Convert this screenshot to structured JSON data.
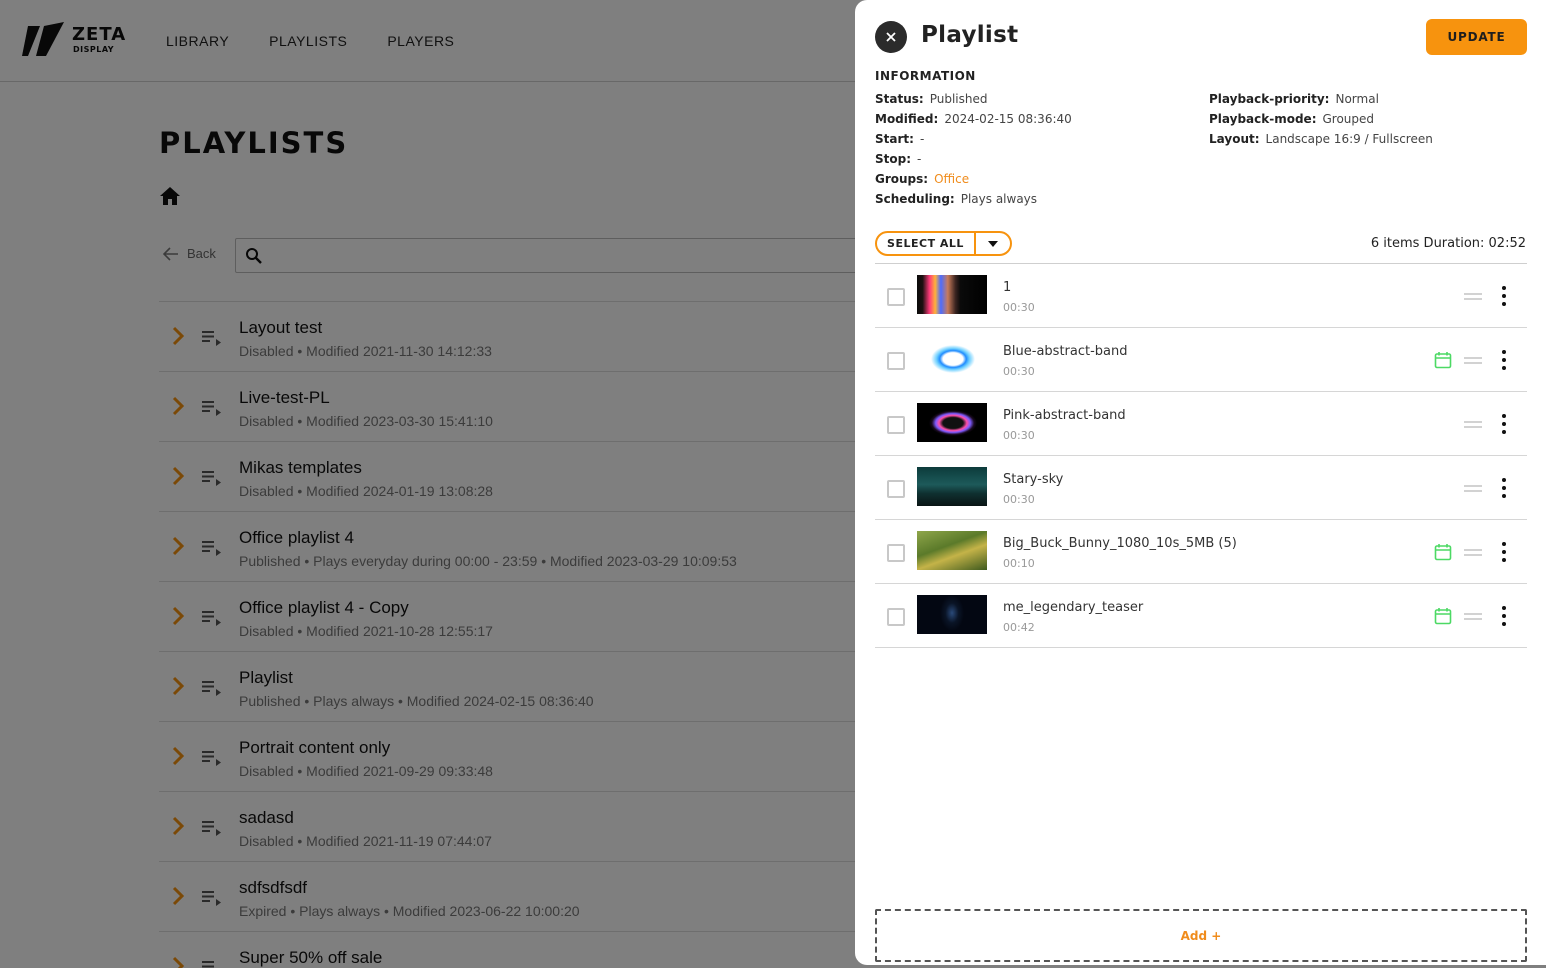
{
  "logo": {
    "word": "ZETA",
    "sub": "DISPLAY"
  },
  "nav": [
    "LIBRARY",
    "PLAYLISTS",
    "PLAYERS"
  ],
  "page": {
    "title": "PLAYLISTS",
    "back_label": "Back",
    "search_placeholder": ""
  },
  "playlists": [
    {
      "name": "Layout test",
      "meta": "Disabled • Modified 2021-11-30 14:12:33"
    },
    {
      "name": "Live-test-PL",
      "meta": "Disabled • Modified 2023-03-30 15:41:10"
    },
    {
      "name": "Mikas templates",
      "meta": "Disabled • Modified 2024-01-19 13:08:28"
    },
    {
      "name": "Office playlist 4",
      "meta": "Published • Plays everyday during 00:00 - 23:59 • Modified 2023-03-29 10:09:53"
    },
    {
      "name": "Office playlist 4 - Copy",
      "meta": "Disabled • Modified 2021-10-28 12:55:17"
    },
    {
      "name": "Playlist",
      "meta": "Published • Plays always • Modified 2024-02-15 08:36:40"
    },
    {
      "name": "Portrait content only",
      "meta": "Disabled • Modified 2021-09-29 09:33:48"
    },
    {
      "name": "sadasd",
      "meta": "Disabled • Modified 2021-11-19 07:44:07"
    },
    {
      "name": "sdfsdfsdf",
      "meta": "Expired • Plays always • Modified 2023-06-22 10:00:20"
    },
    {
      "name": "Super 50% off sale",
      "meta": ""
    }
  ],
  "drawer": {
    "title": "Playlist",
    "update_label": "UPDATE",
    "info_heading": "INFORMATION",
    "info_left": [
      {
        "key": "Status:",
        "value": "Published"
      },
      {
        "key": "Modified:",
        "value": "2024-02-15 08:36:40"
      },
      {
        "key": "Start:",
        "value": "-"
      },
      {
        "key": "Stop:",
        "value": "-"
      },
      {
        "key": "Groups:",
        "value": "Office"
      },
      {
        "key": "Scheduling:",
        "value": "Plays always"
      }
    ],
    "info_right": [
      {
        "key": "Playback-priority:",
        "value": "Normal"
      },
      {
        "key": "Playback-mode:",
        "value": "Grouped"
      },
      {
        "key": "Layout:",
        "value": "Landscape 16:9 / Fullscreen"
      }
    ],
    "select_all_label": "SELECT ALL",
    "summary": "6 items  Duration: 02:52",
    "items": [
      {
        "name": "1",
        "duration": "00:30",
        "scheduled": false
      },
      {
        "name": "Blue-abstract-band",
        "duration": "00:30",
        "scheduled": true
      },
      {
        "name": "Pink-abstract-band",
        "duration": "00:30",
        "scheduled": false
      },
      {
        "name": "Stary-sky",
        "duration": "00:30",
        "scheduled": false
      },
      {
        "name": "Big_Buck_Bunny_1080_10s_5MB (5)",
        "duration": "00:10",
        "scheduled": true
      },
      {
        "name": "me_legendary_teaser",
        "duration": "00:42",
        "scheduled": true
      }
    ],
    "add_label": "Add +"
  },
  "colors": {
    "accent": "#f7930e",
    "schedule_icon": "#4cd964",
    "overlay": "rgba(0,0,0,0.5)"
  }
}
